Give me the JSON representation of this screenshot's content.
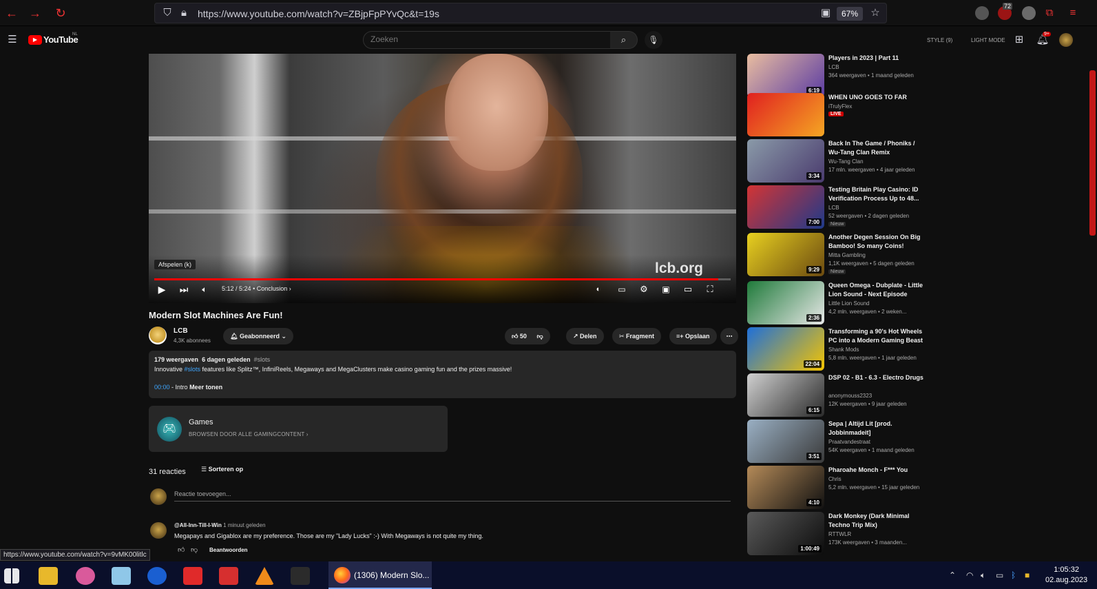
{
  "browser": {
    "url": "https://www.youtube.com/watch?v=ZBjpFpPYvQc&t=19s",
    "zoom": "67%",
    "ext_badge_count": "72"
  },
  "header": {
    "logo_text": "YouTube",
    "logo_region": "NL",
    "search_placeholder": "Zoeken",
    "style_label": "STYLE (9)",
    "light_mode_label": "LIGHT MODE",
    "notif_badge": "9+"
  },
  "player": {
    "tooltip": "Afspelen (k)",
    "watermark": "lcb.org",
    "progress": 0.978,
    "time": "5:12 / 5:24",
    "chapter": "Conclusion",
    "chapter_sep": "•"
  },
  "video": {
    "title": "Modern Slot Machines Are Fun!",
    "channel": "LCB",
    "subscribers": "4,3K abonnees",
    "subscribed_label": "Geabonneerd",
    "likes": "50",
    "share_label": "Delen",
    "clip_label": "Fragment",
    "save_label": "Opslaan"
  },
  "description": {
    "views": "179 weergaven",
    "age": "6 dagen geleden",
    "hashtag": "#slots",
    "text_pre": "Innovative ",
    "text_link": "#slots",
    "text_post": " features like Splitz™, InfiniReels, Megaways and MegaClusters make casino gaming fun and the prizes massive!",
    "chapter_time": "00:00",
    "chapter_text": " - Intro",
    "more_label": "Meer tonen"
  },
  "games": {
    "title": "Games",
    "subtitle": "BROWSEN DOOR ALLE GAMINGCONTENT"
  },
  "comments": {
    "count": "31 reacties",
    "sort_label": "Sorteren op",
    "add_placeholder": "Reactie toevoegen...",
    "items": [
      {
        "author": "@All-Inn-Till-I-Win",
        "time": "1 minuut geleden",
        "text": "Megapays and Gigablox are my preference. Those are my \"Lady Lucks\" :-) With Megaways is not quite my thing.",
        "reply_label": "Beantwoorden"
      }
    ]
  },
  "status_url": "https://www.youtube.com/watch?v=9vMK00litlc",
  "recommendations": [
    {
      "title": "Players in 2023 | Part 11",
      "channel": "LCB",
      "meta": "364 weergaven • 1 maand geleden",
      "duration": "6:19",
      "colors": [
        "#e9bda0",
        "#5b3ca3"
      ]
    },
    {
      "title": "WHEN UNO GOES TO FAR",
      "channel": "iTrulyFlex",
      "meta": "",
      "live": "LIVE",
      "duration": "",
      "colors": [
        "#e02020",
        "#f5a623"
      ]
    },
    {
      "title": "Back In The Game / Phoniks / Wu-Tang Clan Remix",
      "channel": "Wu-Tang Clan",
      "meta": "17 mln. weergaven • 4 jaar geleden",
      "duration": "3:34",
      "colors": [
        "#8a9aa8",
        "#4a3b6e"
      ]
    },
    {
      "title": "Testing Britain Play Casino: ID Verification Process Up to 48...",
      "channel": "LCB",
      "meta": "52 weergaven • 2 dagen geleden",
      "badge": "Nieuw",
      "duration": "7:00",
      "colors": [
        "#d43434",
        "#1e3a8a"
      ]
    },
    {
      "title": "Another Degen Session On Big Bamboo! So many Coins!",
      "channel": "Mitta Gambling",
      "meta": "1,1K weergaven • 5 dagen geleden",
      "badge": "Nieuw",
      "duration": "9:29",
      "colors": [
        "#e8d020",
        "#6b4a10"
      ]
    },
    {
      "title": "Queen Omega - Dubplate - Little Lion Sound - Next Episode",
      "channel": "Little Lion Sound",
      "meta": "4,2 mln. weergaven • 2 weken...",
      "duration": "2:36",
      "colors": [
        "#1f7a3a",
        "#e8e8e8"
      ]
    },
    {
      "title": "Transforming a 90's Hot Wheels PC into a Modern Gaming Beast",
      "channel": "Shank Mods",
      "meta": "5,8 mln. weergaven • 1 jaar geleden",
      "duration": "22:04",
      "colors": [
        "#1e6fd9",
        "#f5c400"
      ]
    },
    {
      "title": "DSP 02 - B1 - 6.3 - Electro Drugs",
      "channel": "anonymouss2323",
      "meta": "12K weergaven • 9 jaar geleden",
      "duration": "6:15",
      "colors": [
        "#d0d0d0",
        "#2a2a2a"
      ]
    },
    {
      "title": "Sepa | Altijd Lit [prod. Jobbinmadeit]",
      "channel": "Praatvandestraat",
      "meta": "54K weergaven • 1 maand geleden",
      "duration": "3:51",
      "colors": [
        "#9ab0c4",
        "#3a3a3a"
      ]
    },
    {
      "title": "Pharoahe Monch - F*** You",
      "channel": "Chris",
      "meta": "5,2 mln. weergaven • 15 jaar geleden",
      "duration": "4:10",
      "colors": [
        "#b48a58",
        "#111111"
      ]
    },
    {
      "title": "Dark Monkey (Dark Minimal Techno Trip Mix)",
      "channel": "RTTWLR",
      "meta": "173K weergaven • 3 maanden...",
      "duration": "1:00:49",
      "colors": [
        "#5a5a5a",
        "#0c0c0c"
      ]
    }
  ],
  "taskbar": {
    "active_task": "(1306) Modern Slo...",
    "time": "1:05:32",
    "date": "02.aug.2023"
  }
}
